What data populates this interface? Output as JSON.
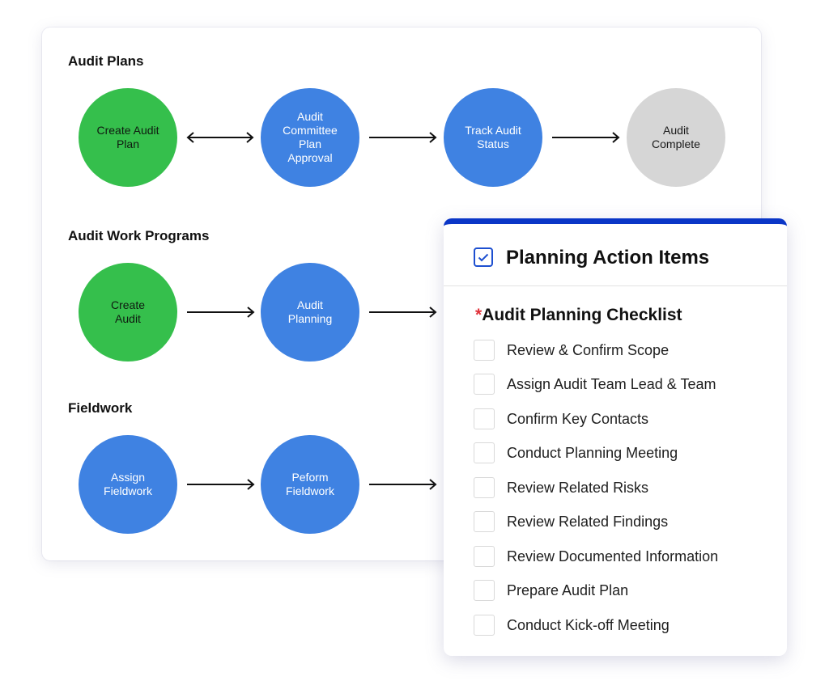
{
  "sections": [
    {
      "title": "Audit Plans",
      "nodes": [
        {
          "label": "Create Audit Plan",
          "status": "green"
        },
        {
          "label": "Audit Committee Plan Approval",
          "status": "blue"
        },
        {
          "label": "Track Audit Status",
          "status": "blue"
        },
        {
          "label": "Audit Complete",
          "status": "gray"
        }
      ],
      "connectors": [
        "bidirectional",
        "forward",
        "forward"
      ]
    },
    {
      "title": "Audit Work Programs",
      "nodes": [
        {
          "label": "Create Audit",
          "status": "green"
        },
        {
          "label": "Audit Planning",
          "status": "blue"
        }
      ],
      "connectors": [
        "forward",
        "forward"
      ]
    },
    {
      "title": "Fieldwork",
      "nodes": [
        {
          "label": "Assign Fieldwork",
          "status": "blue"
        },
        {
          "label": "Peform Fieldwork",
          "status": "blue"
        }
      ],
      "connectors": [
        "forward",
        "forward"
      ]
    }
  ],
  "colors": {
    "green": "#35bf4c",
    "blue": "#3f82e2",
    "gray": "#d6d6d6",
    "accent": "#0a36c7",
    "required": "#e0323a"
  },
  "panel": {
    "title": "Planning Action Items",
    "header_icon": "checkbox-checked-icon",
    "checklist_required_mark": "*",
    "checklist_title": "Audit Planning Checklist",
    "items": [
      {
        "label": "Review & Confirm Scope",
        "checked": false
      },
      {
        "label": "Assign Audit Team Lead & Team",
        "checked": false
      },
      {
        "label": "Confirm Key Contacts",
        "checked": false
      },
      {
        "label": "Conduct Planning Meeting",
        "checked": false
      },
      {
        "label": "Review Related Risks",
        "checked": false
      },
      {
        "label": "Review Related Findings",
        "checked": false
      },
      {
        "label": "Review Documented Information",
        "checked": false
      },
      {
        "label": "Prepare Audit Plan",
        "checked": false
      },
      {
        "label": "Conduct Kick-off Meeting",
        "checked": false
      }
    ]
  }
}
